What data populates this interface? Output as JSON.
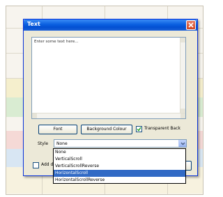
{
  "dialog": {
    "title": "Text",
    "textarea_placeholder": "Enter some text here...",
    "font_button": "Font",
    "background_button": "Background Colour",
    "transparent_label": "Transparent Back",
    "transparent_checked": true,
    "style_label": "Style",
    "style_value": "None",
    "add_label": "Add di"
  },
  "dropdown": {
    "options": [
      "None",
      "VerticalScroll",
      "VerticalScrollReverse",
      "HorizontalScroll",
      "HorizontalScrollReverse"
    ],
    "selected_index": 3
  },
  "colors": {
    "titlebar": "#0a5fe0",
    "selection": "#316ac5",
    "dialog_bg": "#ece9d8",
    "close": "#d2451f"
  }
}
